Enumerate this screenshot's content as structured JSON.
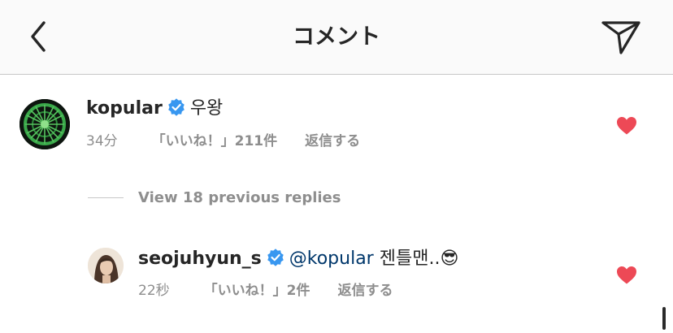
{
  "header": {
    "title": "コメント",
    "back_icon": "chevron-left-icon",
    "send_icon": "paper-plane-icon"
  },
  "comments": [
    {
      "username": "kopular",
      "verified": true,
      "text": "우왕",
      "time": "34分",
      "likes": "「いいね！」211件",
      "reply_label": "返信する",
      "liked": true
    },
    {
      "username": "seojuhyun_s",
      "verified": true,
      "mention": "@kopular",
      "text": " 젠틀맨..",
      "emoji": "😎",
      "time": "22秒",
      "likes": "「いいね！」2件",
      "reply_label": "返信する",
      "liked": true
    }
  ],
  "view_replies": "View 18 previous replies",
  "colors": {
    "heart": "#ed4956",
    "verified": "#3897f0",
    "mention": "#00376b",
    "meta": "#8e8e8e"
  }
}
